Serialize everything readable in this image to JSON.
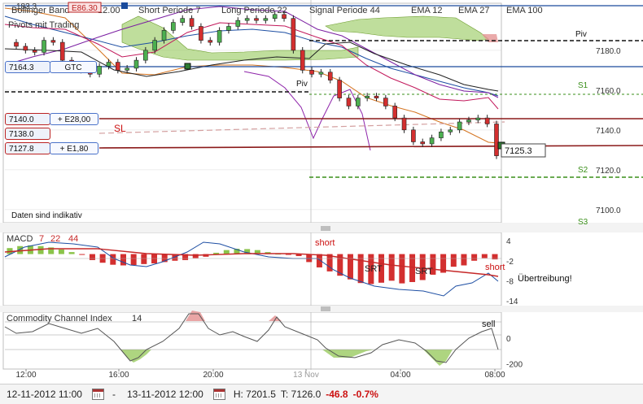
{
  "header": {
    "bollinger": "Bollinger Band",
    "bollinger_val": "12.00",
    "e_label": "E86.30",
    "short_period": "Short Periode 7",
    "long_period": "Long Periode 22",
    "signal_period": "Signal Periode 44",
    "ema1": "EMA 12",
    "ema2": "EMA 27",
    "ema3": "EMA 100",
    "pivot_tag": "Pivots mit Trading",
    "price_183": "183.3"
  },
  "orders": {
    "gtc_price": "7164.3",
    "gtc_label": "GTC",
    "o1_price": "7140.0",
    "o1_label": "+ E28,00",
    "o2_price": "7138.0",
    "o3_price": "7127.8",
    "o3_label": "+ E1,80"
  },
  "annotations": {
    "sl": "SL",
    "piv": "Piv",
    "piv_left": "Piv",
    "s1": "S1",
    "s2": "S2",
    "s3": "S3",
    "indicative": "Daten sind indikativ",
    "current_price": "7125.3"
  },
  "price_axis": {
    "ticks": [
      "7180.0",
      "7160.0",
      "7140.0",
      "7120.0",
      "7100.0"
    ]
  },
  "macd": {
    "title": "MACD",
    "p1": "7",
    "p2": "22",
    "p3": "44",
    "short1": "short",
    "short2": "short",
    "srt1": "SRT",
    "srt2": "SRT",
    "uebertreibung": "Übertreibung!",
    "ticks": [
      "4",
      "-2",
      "-8",
      "-14"
    ]
  },
  "cci": {
    "title": "Commodity Channel Index",
    "period": "14",
    "sell": "sell",
    "ticks": [
      "0",
      "-200"
    ]
  },
  "time_axis": {
    "labels": [
      "12:00",
      "16:00",
      "20:00",
      "13 Nov",
      "04:00",
      "08:00"
    ]
  },
  "status": {
    "from": "12-11-2012 11:00",
    "dash": "-",
    "to": "13-11-2012 12:00",
    "high": "H: 7201.5",
    "last": "T: 7126.0",
    "change": "-46.8",
    "pct": "-0.7%"
  },
  "colors": {
    "up_candle": "#4caf50",
    "down_candle": "#d32f2f",
    "cloud": "#8bc34a",
    "resistance": "#8b1a1a",
    "support": "#3a8f1a",
    "axis_line": "#1a4b9c"
  },
  "chart_data": [
    {
      "type": "line",
      "name": "price",
      "ylim": [
        7095,
        7202
      ],
      "ticks": [
        7180,
        7160,
        7140,
        7120,
        7100
      ],
      "close": [
        7182,
        7180,
        7179,
        7185,
        7184,
        7175,
        7172,
        7170,
        7168,
        7172,
        7174,
        7170,
        7171,
        7175,
        7180,
        7185,
        7190,
        7194,
        7196,
        7192,
        7185,
        7184,
        7190,
        7192,
        7195,
        7196,
        7195,
        7196,
        7198,
        7196,
        7180,
        7170,
        7168,
        7169,
        7165,
        7156,
        7152,
        7156,
        7157,
        7156,
        7152,
        7146,
        7140,
        7134,
        7133,
        7136,
        7139,
        7140,
        7144,
        7145,
        7146,
        7143,
        7127
      ],
      "levels": {
        "pivot": 7176,
        "s1": 7151,
        "s2": 7113,
        "order_gtc": 7164.3,
        "order_1": 7140.0,
        "order_2": 7138.0,
        "order_3": 7127.8
      }
    },
    {
      "type": "bar",
      "name": "MACD",
      "ylim": [
        -15,
        6
      ],
      "ticks": [
        4,
        -2,
        -8,
        -14
      ],
      "values": [
        1.8,
        2.4,
        2.6,
        2.4,
        2.0,
        1.4,
        0.6,
        -0.2,
        -1.8,
        -2.6,
        -3.2,
        -3.4,
        -3.3,
        -3.0,
        -2.8,
        -2.4,
        -2.0,
        -1.8,
        -1.2,
        -0.8,
        0.4,
        1.2,
        1.6,
        1.5,
        1.2,
        0.6,
        0.1,
        -0.1,
        -0.6,
        -2.4,
        -4.0,
        -5.2,
        -6.5,
        -7.6,
        -8.7,
        -9.0,
        -8.6,
        -8.0,
        -8.8,
        -8.4,
        -7.8,
        -6.2,
        -5.6,
        -3.8,
        -3.4,
        -2.0,
        -1.2,
        -1.6
      ]
    },
    {
      "type": "line",
      "name": "CCI",
      "ylim": [
        -230,
        190
      ],
      "ticks": [
        0,
        -200
      ],
      "values": [
        -60,
        20,
        110,
        60,
        -20,
        -140,
        -80,
        -40,
        30,
        110,
        160,
        90,
        60,
        40,
        20,
        40,
        30,
        10,
        -40,
        -50,
        -70,
        -40,
        0,
        10,
        20,
        -20,
        -60,
        -100,
        -90,
        -80,
        -100,
        -150,
        -170,
        -150,
        -140,
        -130,
        -90,
        -70,
        -60,
        -40,
        -20,
        0,
        20,
        40,
        60,
        80,
        90,
        70,
        -140
      ]
    }
  ]
}
